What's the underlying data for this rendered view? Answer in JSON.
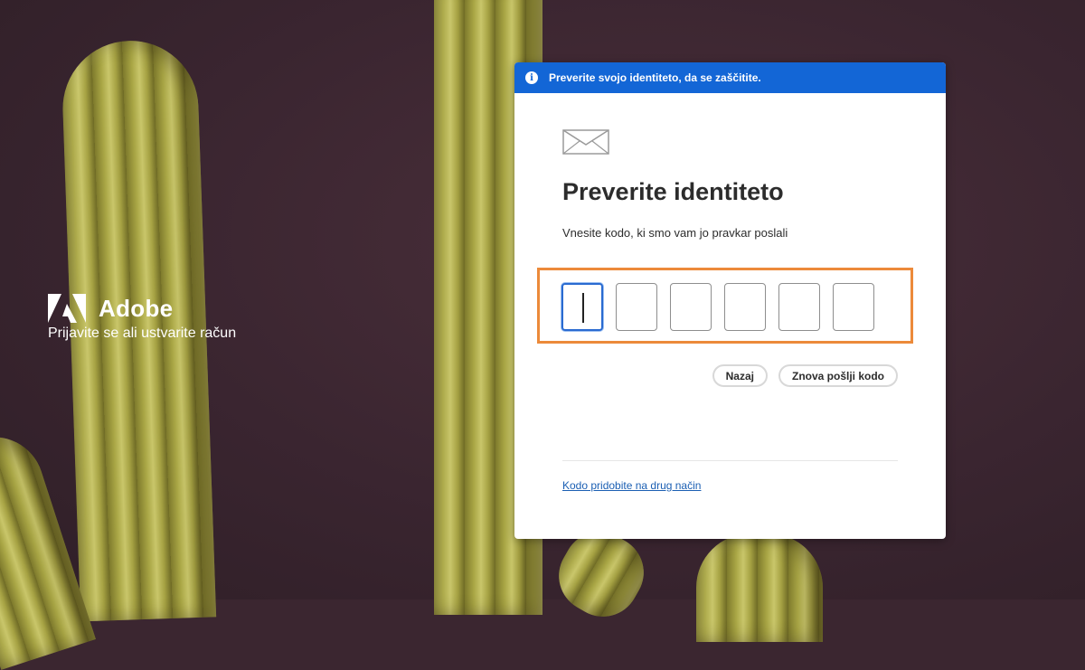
{
  "brand": {
    "name": "Adobe",
    "tagline": "Prijavite se ali ustvarite račun"
  },
  "dialog": {
    "banner_text": "Preverite svojo identiteto, da se zaščitite.",
    "banner_icon": "info-icon",
    "envelope_icon": "mail-icon",
    "title": "Preverite identiteto",
    "subtitle": "Vnesite kodo, ki smo vam jo pravkar poslali",
    "code_digits": [
      "",
      "",
      "",
      "",
      "",
      ""
    ],
    "buttons": {
      "back": "Nazaj",
      "resend": "Znova pošlji kodo"
    },
    "alt_link": "Kodo pridobite na drug način"
  },
  "colors": {
    "banner": "#1366d6",
    "highlight_frame": "#ec8a3a",
    "link": "#1b5fb3",
    "background": "#3b2630"
  }
}
